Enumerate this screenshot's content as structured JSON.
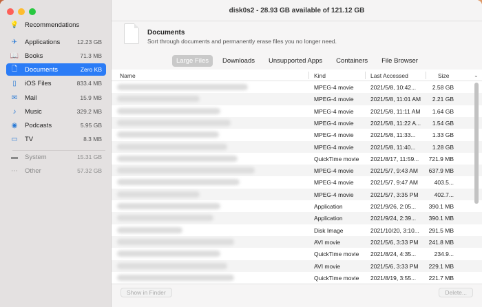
{
  "window": {
    "title": "disk0s2 - 28.93 GB available of 121.12 GB"
  },
  "sidebar": {
    "items": [
      {
        "label": "Recommendations",
        "size": "",
        "icon": "lightbulb-icon",
        "glyph": "💡"
      },
      {
        "label": "Applications",
        "size": "12.23 GB",
        "icon": "applications-icon",
        "glyph": "✈"
      },
      {
        "label": "Books",
        "size": "71.3 MB",
        "icon": "book-icon",
        "glyph": "📖"
      },
      {
        "label": "Documents",
        "size": "Zero KB",
        "icon": "document-icon",
        "glyph": "🗋"
      },
      {
        "label": "iOS Files",
        "size": "833.4 MB",
        "icon": "ios-files-icon",
        "glyph": "▯"
      },
      {
        "label": "Mail",
        "size": "15.9 MB",
        "icon": "mail-icon",
        "glyph": "✉"
      },
      {
        "label": "Music",
        "size": "329.2 MB",
        "icon": "music-icon",
        "glyph": "♪"
      },
      {
        "label": "Podcasts",
        "size": "5.95 GB",
        "icon": "podcast-icon",
        "glyph": "◉"
      },
      {
        "label": "TV",
        "size": "8.3 MB",
        "icon": "tv-icon",
        "glyph": "▭"
      },
      {
        "label": "System",
        "size": "15.31 GB",
        "icon": "system-drive-icon",
        "glyph": "▬"
      },
      {
        "label": "Other",
        "size": "57.32 GB",
        "icon": "other-icon",
        "glyph": "⋯"
      }
    ]
  },
  "header": {
    "title": "Documents",
    "subtitle": "Sort through documents and permanently erase files you no longer need."
  },
  "tabs": [
    "Large Files",
    "Downloads",
    "Unsupported Apps",
    "Containers",
    "File Browser"
  ],
  "columns": {
    "name": "Name",
    "kind": "Kind",
    "last_accessed": "Last Accessed",
    "size": "Size"
  },
  "rows": [
    {
      "kind": "MPEG-4 movie",
      "date": "2021/5/8, 10:42...",
      "size": "2.58 GB"
    },
    {
      "kind": "MPEG-4 movie",
      "date": "2021/5/8, 11:01 AM",
      "size": "2.21 GB"
    },
    {
      "kind": "MPEG-4 movie",
      "date": "2021/5/8, 11:11 AM",
      "size": "1.64 GB"
    },
    {
      "kind": "MPEG-4 movie",
      "date": "2021/5/8, 11:22 A...",
      "size": "1.54 GB"
    },
    {
      "kind": "MPEG-4 movie",
      "date": "2021/5/8, 11:33...",
      "size": "1.33 GB"
    },
    {
      "kind": "MPEG-4 movie",
      "date": "2021/5/8, 11:40...",
      "size": "1.28 GB"
    },
    {
      "kind": "QuickTime movie",
      "date": "2021/8/17, 11:59...",
      "size": "721.9 MB"
    },
    {
      "kind": "MPEG-4 movie",
      "date": "2021/5/7, 9:43 AM",
      "size": "637.9 MB"
    },
    {
      "kind": "MPEG-4 movie",
      "date": "2021/5/7, 9:47 AM",
      "size": "403.5..."
    },
    {
      "kind": "MPEG-4 movie",
      "date": "2021/5/7, 3:35 PM",
      "size": "402.7..."
    },
    {
      "kind": "Application",
      "date": "2021/9/26, 2:05...",
      "size": "390.1 MB"
    },
    {
      "kind": "Application",
      "date": "2021/9/24, 2:39...",
      "size": "390.1 MB"
    },
    {
      "kind": "Disk Image",
      "date": "2021/10/20, 3:10...",
      "size": "291.5 MB"
    },
    {
      "kind": "AVI movie",
      "date": "2021/5/6, 3:33 PM",
      "size": "241.8 MB"
    },
    {
      "kind": "QuickTime movie",
      "date": "2021/8/24, 4:35...",
      "size": "234.9..."
    },
    {
      "kind": "AVI movie",
      "date": "2021/5/6, 3:33 PM",
      "size": "229.1 MB"
    },
    {
      "kind": "QuickTime movie",
      "date": "2021/8/19, 3:55...",
      "size": "221.7 MB"
    }
  ],
  "footer": {
    "show_in_finder": "Show in Finder",
    "delete": "Delete..."
  }
}
